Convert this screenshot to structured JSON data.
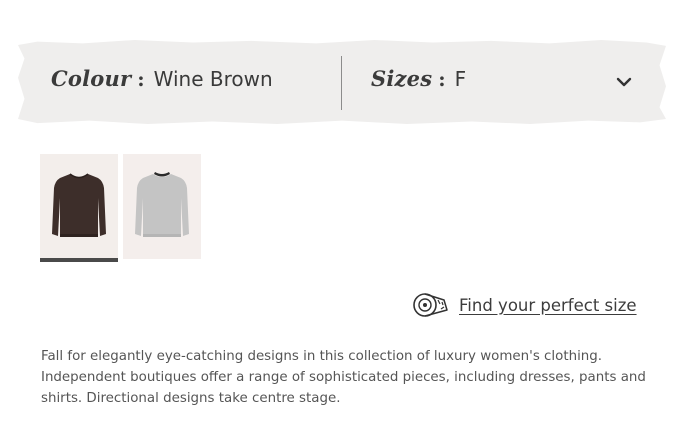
{
  "selector": {
    "colour_label": "Colour",
    "colour_value": "Wine Brown",
    "sizes_label": "Sizes",
    "sizes_value": "F",
    "colon": ":"
  },
  "swatches": [
    {
      "name": "Wine Brown",
      "color": "#3d2e2a",
      "selected": true
    },
    {
      "name": "Grey",
      "color": "#c4c4c4",
      "selected": false
    }
  ],
  "size_guide": {
    "link_text": "Find your perfect size",
    "icon": "measuring-tape-icon"
  },
  "description": "Fall for elegantly eye-catching designs in this collection of luxury women's clothing. Independent boutiques offer a range of sophisticated pieces, including dresses, pants and shirts. Directional designs take centre stage.",
  "colors": {
    "band": "#efeeed",
    "text": "#3a3a3a",
    "selected_underline": "#4a4a4a"
  }
}
